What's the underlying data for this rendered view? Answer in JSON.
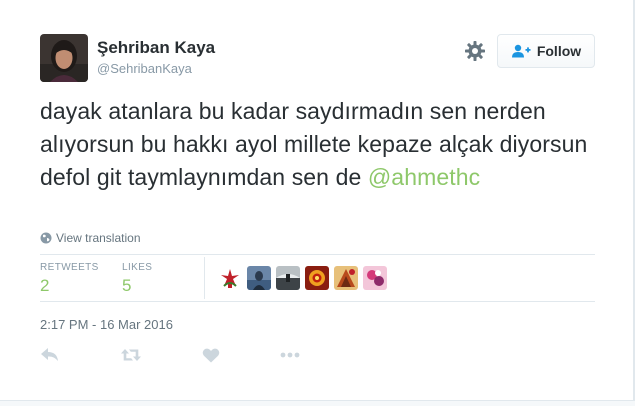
{
  "user": {
    "fullname": "Şehriban Kaya",
    "username": "@SehribanKaya"
  },
  "header": {
    "follow_label": "Follow",
    "gear_icon": "gear-icon",
    "follow_icon": "add-user-icon"
  },
  "tweet": {
    "text": "dayak atanlara bu kadar saydırmadın sen nerden alıyorsun bu hakkı ayol millete kepaze alçak diyorsun defol git taymlaynımdan sen de",
    "mention": "@ahmethc",
    "translate_label": "View translation"
  },
  "stats": {
    "retweets_label": "RETWEETS",
    "retweets_count": "2",
    "likes_label": "LIKES",
    "likes_count": "5"
  },
  "likers": [
    "liker-avatar-1",
    "liker-avatar-2",
    "liker-avatar-3",
    "liker-avatar-4",
    "liker-avatar-5",
    "liker-avatar-6"
  ],
  "timestamp": "2:17 PM - 16 Mar 2016",
  "actions": [
    "reply-icon",
    "retweet-icon",
    "like-heart-icon",
    "more-icon"
  ],
  "colors": {
    "accent": "#8ec86a",
    "text": "#292f33",
    "muted": "#8899a6",
    "border": "#e1e8ed"
  }
}
